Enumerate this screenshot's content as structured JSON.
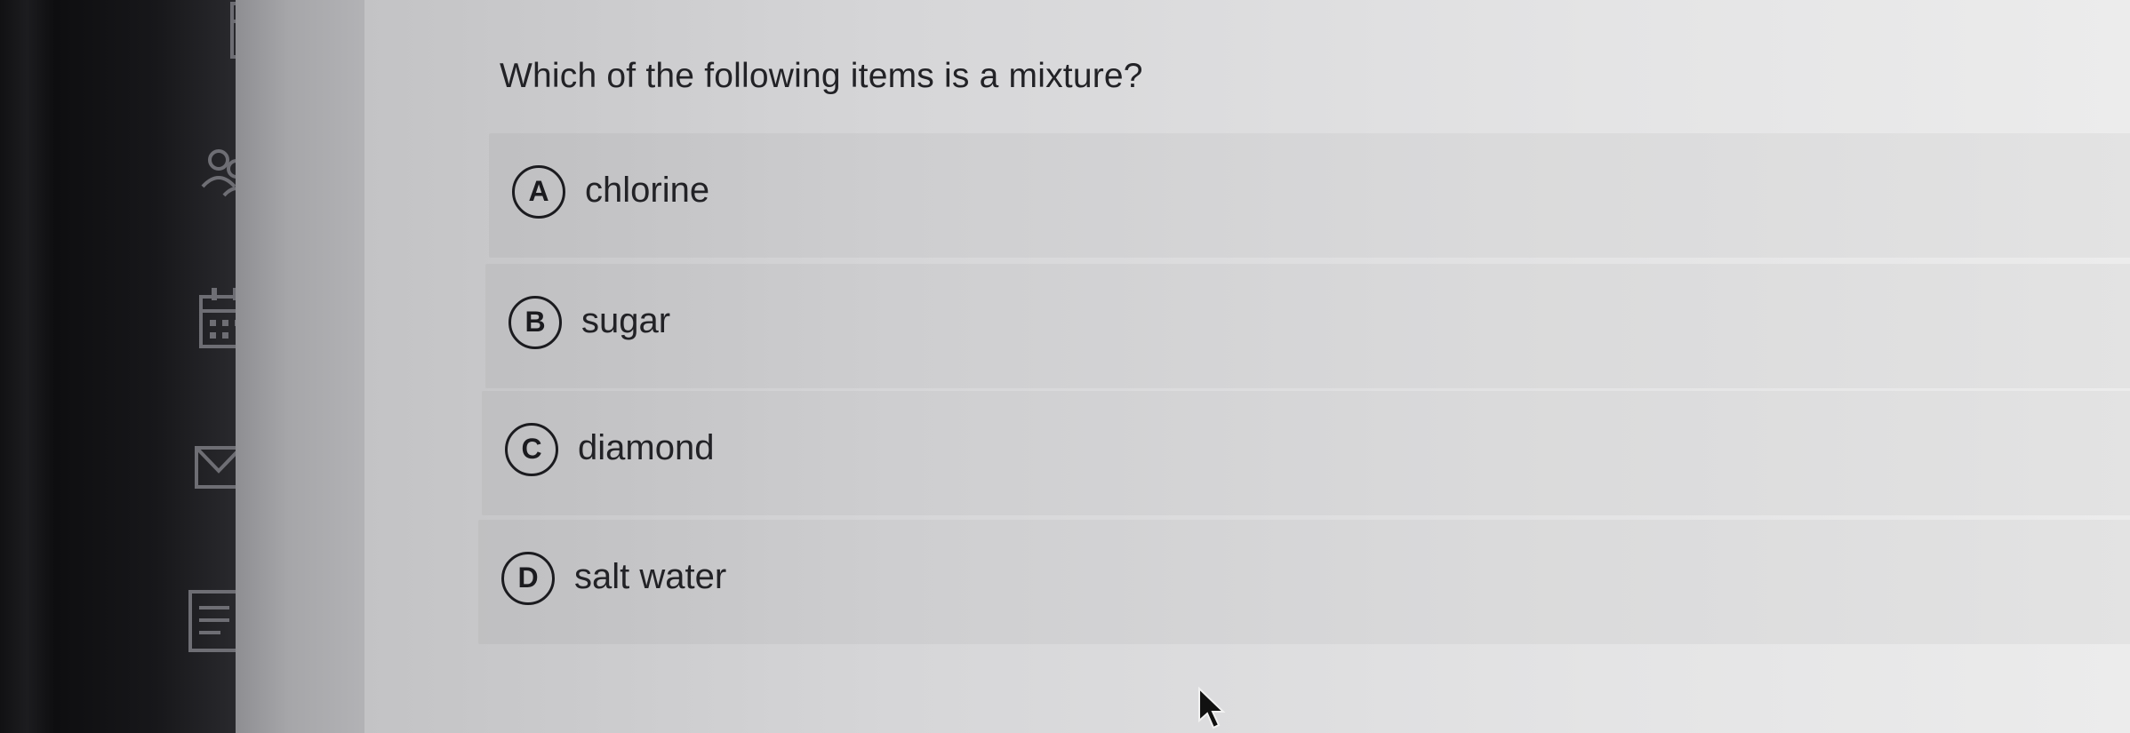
{
  "question": {
    "text": "Which of the following items is a mixture?"
  },
  "choices": [
    {
      "letter": "A",
      "label": "chlorine"
    },
    {
      "letter": "B",
      "label": "sugar"
    },
    {
      "letter": "C",
      "label": "diamond"
    },
    {
      "letter": "D",
      "label": "salt water"
    }
  ],
  "sidebar": {
    "icons": [
      "calculator-icon",
      "people-icon",
      "calendar-icon",
      "mail-icon",
      "notes-icon"
    ]
  }
}
